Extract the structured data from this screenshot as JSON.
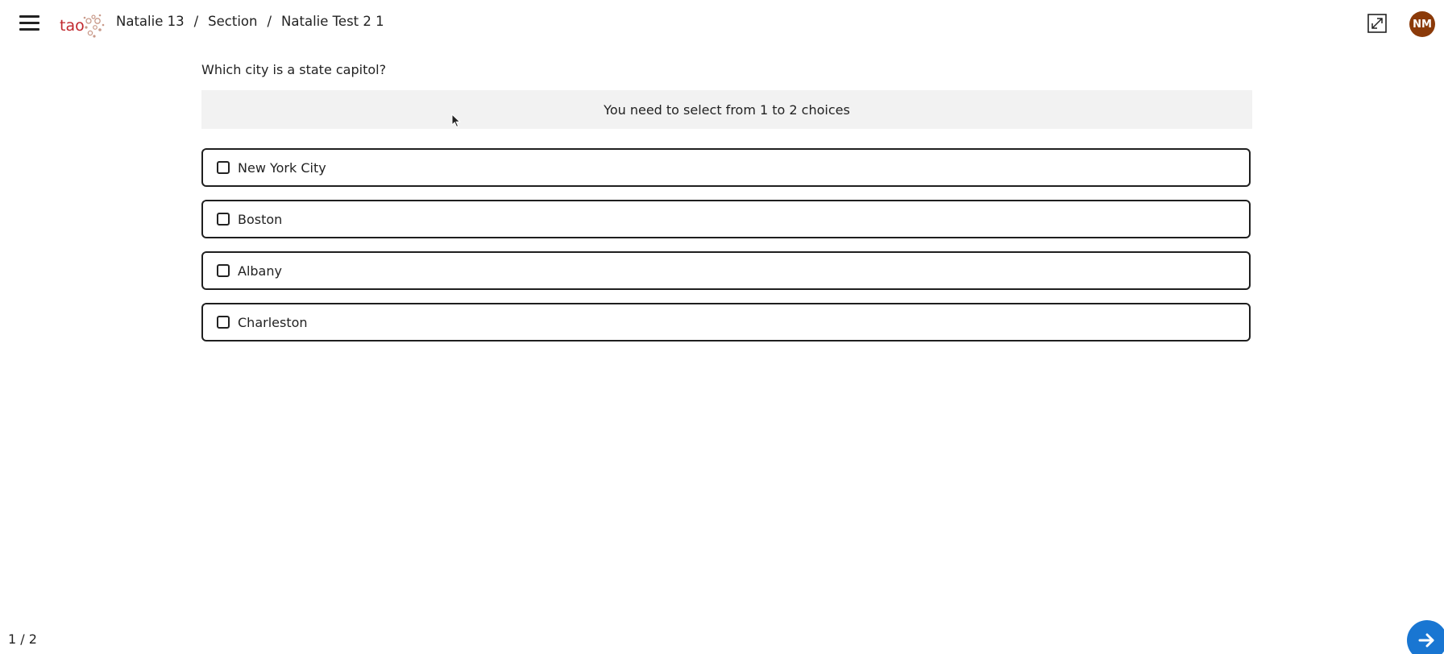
{
  "header": {
    "logo_text": "tao",
    "breadcrumb": [
      {
        "label": "Natalie 13"
      },
      {
        "label": "Section"
      },
      {
        "label": "Natalie Test 2 1"
      }
    ],
    "separator": "/",
    "avatar_initials": "NM",
    "avatar_color": "#8b3a09",
    "logo_color": "#c1272d",
    "icons": {
      "menu": "hamburger-menu-icon",
      "fullscreen": "expand-icon"
    }
  },
  "item": {
    "prompt": "Which city is a state capitol?",
    "constraint": "You need to select from 1 to 2 choices",
    "choices": [
      {
        "label": "New York City",
        "checked": false
      },
      {
        "label": "Boston",
        "checked": false
      },
      {
        "label": "Albany",
        "checked": false
      },
      {
        "label": "Charleston",
        "checked": false
      }
    ]
  },
  "footer": {
    "pager": "1 / 2",
    "next_icon": "arrow-right-icon",
    "next_color": "#1976d2"
  }
}
